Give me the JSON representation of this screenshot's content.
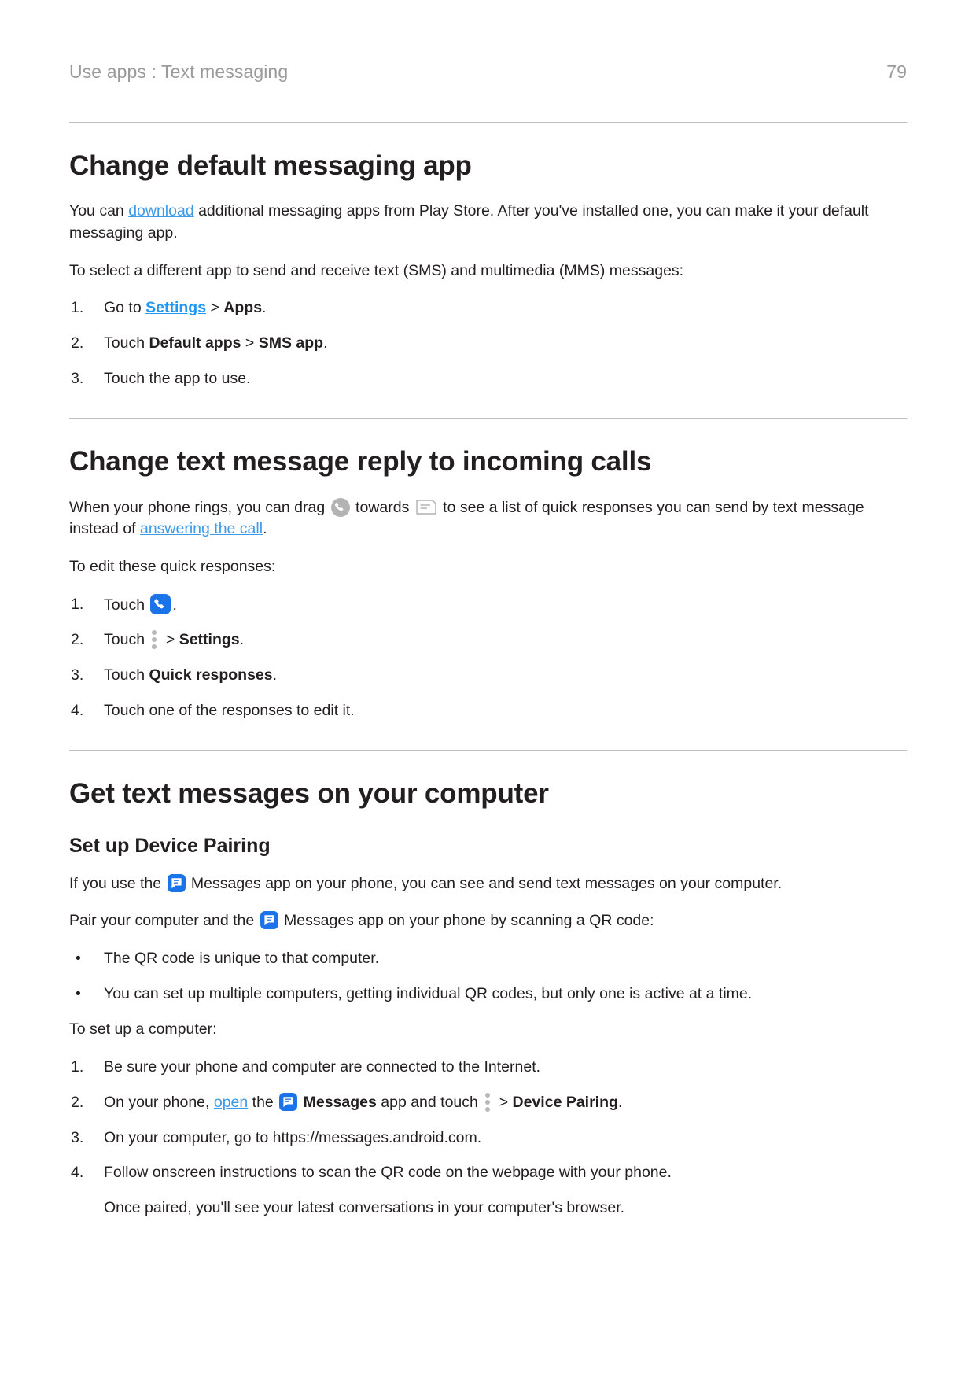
{
  "header": {
    "breadcrumb": "Use apps : Text messaging",
    "page_number": "79"
  },
  "colors": {
    "link": "#3d9ae8",
    "link_strong": "#2196f3",
    "app_blue": "#1a73e8",
    "icon_grey": "#b3b3b3",
    "text": "#231f20",
    "header_grey": "#9a9a9a",
    "rule": "#bfbfbf"
  },
  "sections": [
    {
      "id": "change-default-messaging-app",
      "heading": "Change default messaging app",
      "intro_1_a": "You can ",
      "intro_1_link": "download",
      "intro_1_b": " additional messaging apps from Play Store. After you've installed one, you can make it your default messaging app.",
      "intro_2": "To select a different app to send and receive text (SMS) and multimedia (MMS) messages:",
      "steps": [
        {
          "marker": "1.",
          "a": "Go to ",
          "link": "Settings",
          "b": " > ",
          "bold": "Apps",
          "c": "."
        },
        {
          "marker": "2.",
          "a": "Touch ",
          "bold1": "Default apps",
          "b": " > ",
          "bold2": "SMS app",
          "c": "."
        },
        {
          "marker": "3.",
          "a": "Touch the app to use."
        }
      ]
    },
    {
      "id": "change-text-message-reply",
      "heading": "Change text message reply to incoming calls",
      "intro_a": "When your phone rings, you can drag ",
      "icon_1": "phone-grey-icon",
      "intro_b": " towards ",
      "icon_2": "message-outline-icon",
      "intro_c": " to see a list of quick responses you can send by text message instead of ",
      "intro_link": "answering the call",
      "intro_d": ".",
      "intro_2": "To edit these quick responses:",
      "steps": [
        {
          "marker": "1.",
          "a": "Touch ",
          "icon": "phone-app-blue-icon",
          "c": "."
        },
        {
          "marker": "2.",
          "a": "Touch ",
          "icon": "overflow-menu-icon",
          "b": " > ",
          "bold": "Settings",
          "c": "."
        },
        {
          "marker": "3.",
          "a": "Touch ",
          "bold": "Quick responses",
          "c": "."
        },
        {
          "marker": "4.",
          "a": "Touch one of the responses to edit it."
        }
      ]
    },
    {
      "id": "get-text-messages-on-computer",
      "heading": "Get text messages on your computer",
      "subheading": "Set up Device Pairing",
      "para_1_a": "If you use the ",
      "para_1_icon": "messages-app-icon",
      "para_1_b": " Messages app on your phone, you can see and send text messages on your computer.",
      "para_2_a": "Pair your computer and the ",
      "para_2_icon": "messages-app-icon",
      "para_2_b": " Messages app on your phone by scanning a QR code:",
      "bullets": [
        "The QR code is unique to that computer.",
        "You can set up multiple computers, getting individual QR codes, but only one is active at a time."
      ],
      "para_3": "To set up a computer:",
      "steps": [
        {
          "marker": "1.",
          "a": "Be sure your phone and computer are connected to the Internet."
        },
        {
          "marker": "2.",
          "a": "On your phone, ",
          "link": "open",
          "b": " the ",
          "icon": "messages-app-icon",
          "bold1": "Messages",
          "c": " app and touch ",
          "icon2": "overflow-menu-icon",
          "d": " > ",
          "bold2": "Device Pairing",
          "e": "."
        },
        {
          "marker": "3.",
          "a": "On your computer, go to https://messages.android.com."
        },
        {
          "marker": "4.",
          "a": "Follow onscreen instructions to scan the QR code on the webpage with your phone."
        }
      ],
      "closing_note": "Once paired, you'll see your latest conversations in your computer's browser."
    }
  ]
}
